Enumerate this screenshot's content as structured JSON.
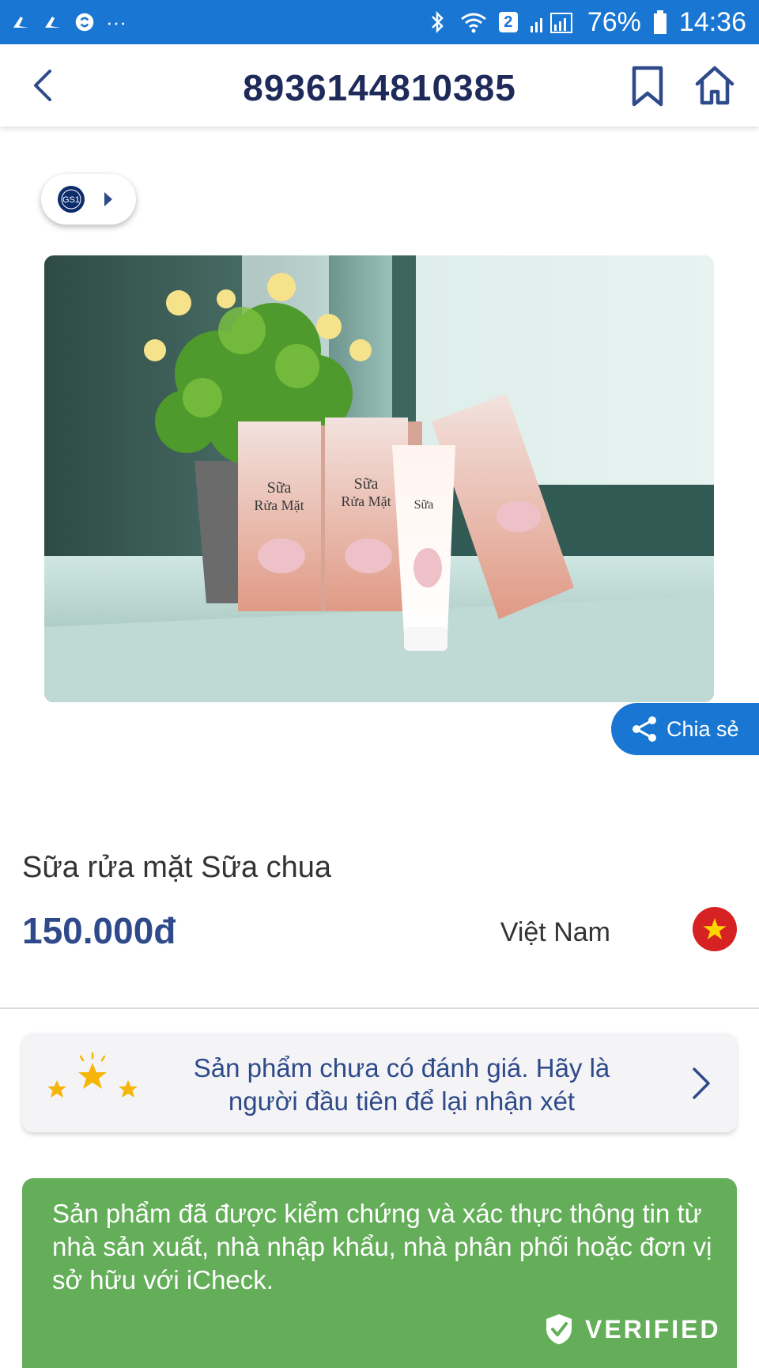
{
  "status_bar": {
    "battery": "76%",
    "time": "14:36",
    "sim_slot": "2",
    "more": "···"
  },
  "app_bar": {
    "title": "8936144810385"
  },
  "product": {
    "name": "Sữa rửa mặt Sữa chua",
    "price": "150.000đ",
    "origin": "Việt Nam",
    "gs1_label": "GS1"
  },
  "share": {
    "label": "Chia sẻ"
  },
  "review": {
    "text": "Sản phẩm chưa có đánh giá. Hãy là người đầu tiên để lại nhận xét"
  },
  "verified": {
    "text": "Sản phẩm đã được kiểm chứng và xác thực thông tin từ nhà sản xuất, nhà nhập khẩu, nhà phân phối hoặc đơn vị sở hữu với iCheck.",
    "badge": "VERIFIED"
  },
  "colors": {
    "primary": "#1976d2",
    "title": "#1e2a5a",
    "price": "#2e4a8a",
    "verified_bg": "#64ae59",
    "flag_red": "#d62222",
    "star": "#f5b50a"
  },
  "icons": {
    "back": "chevron-left-icon",
    "bookmark": "bookmark-icon",
    "home": "home-icon",
    "share": "share-icon",
    "review_chevron": "chevron-right-icon",
    "shield": "shield-check-icon"
  }
}
